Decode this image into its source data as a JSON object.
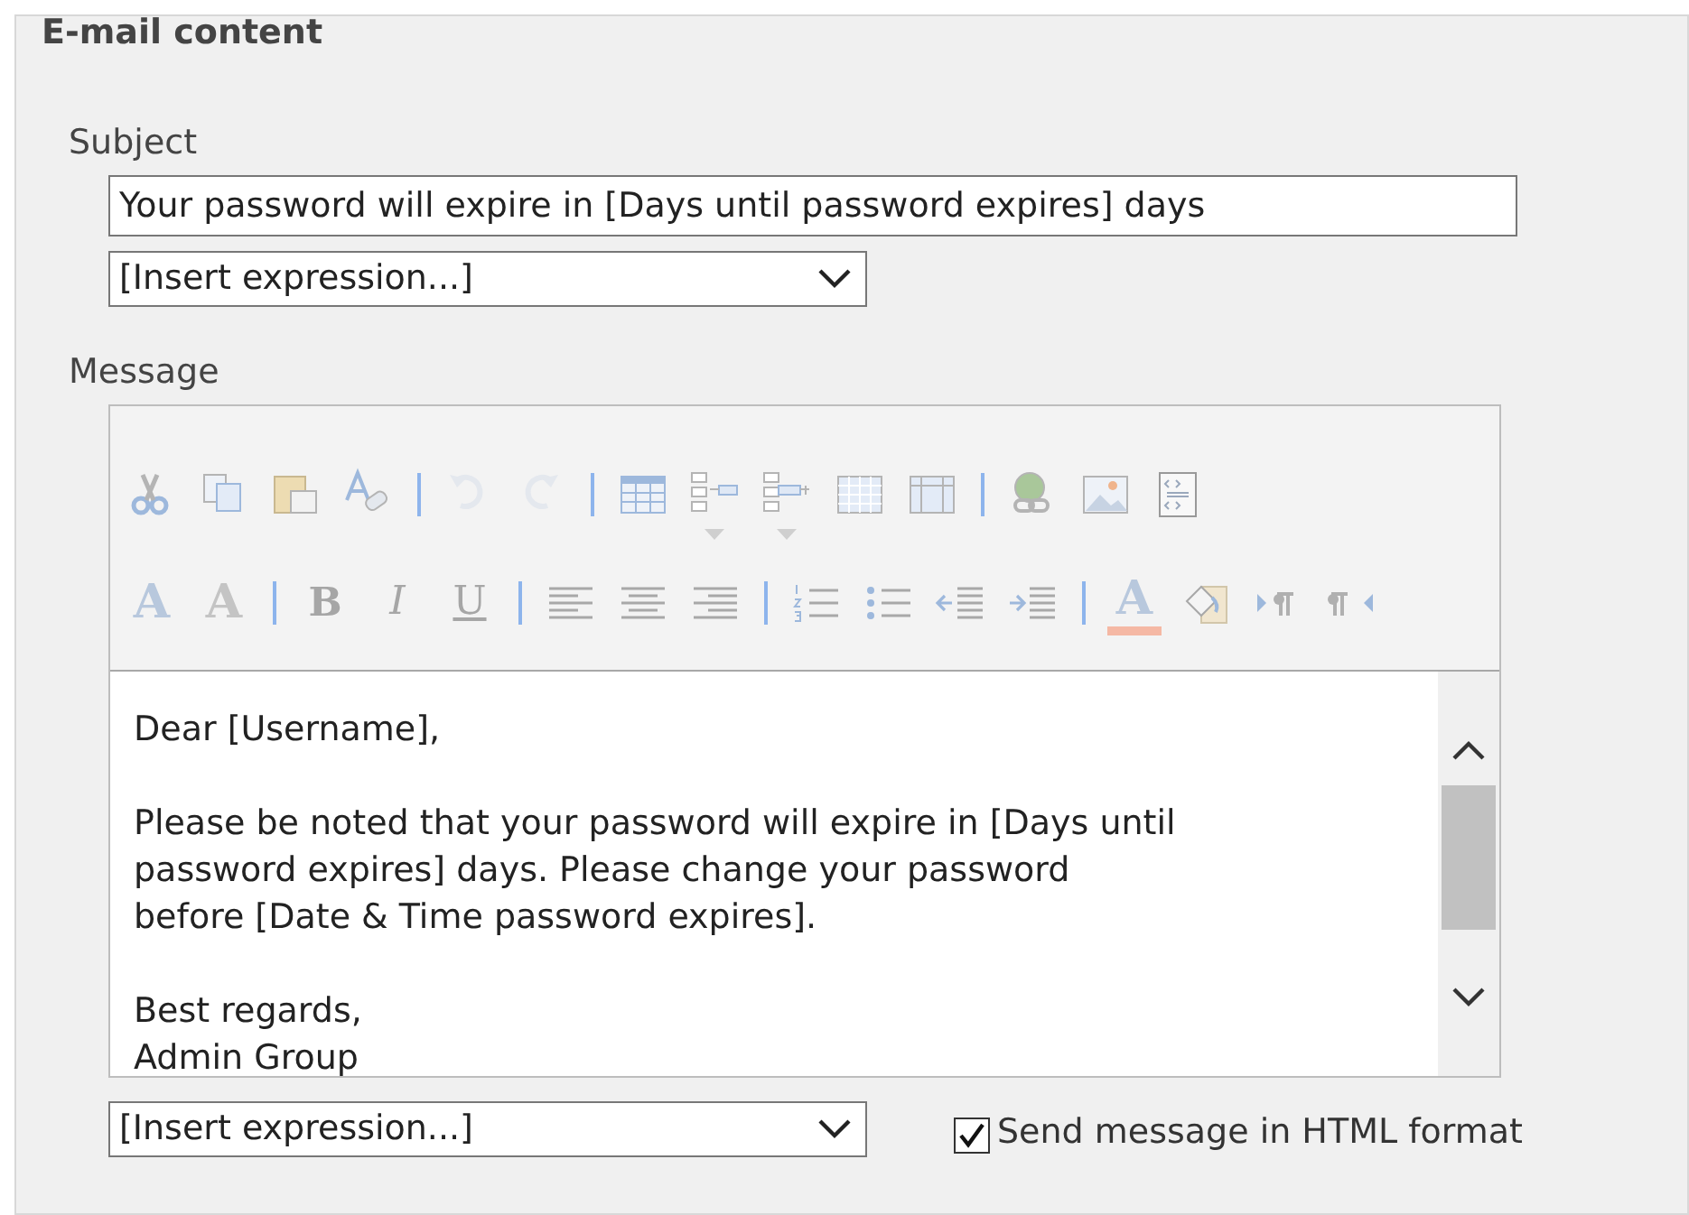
{
  "section": {
    "title": "E-mail content"
  },
  "subject": {
    "label": "Subject",
    "value": "Your password will expire in [Days until password expires] days",
    "expression_select": {
      "value": "[Insert expression...]"
    }
  },
  "message": {
    "label": "Message",
    "toolbar_rows": [
      [
        {
          "kind": "cut"
        },
        {
          "kind": "copy"
        },
        {
          "kind": "paste"
        },
        {
          "kind": "spell"
        },
        {
          "kind": "sep"
        },
        {
          "kind": "undo"
        },
        {
          "kind": "redo"
        },
        {
          "kind": "sep"
        },
        {
          "kind": "table"
        },
        {
          "kind": "insert-row"
        },
        {
          "kind": "insert-col"
        },
        {
          "kind": "grid"
        },
        {
          "kind": "table-props"
        },
        {
          "kind": "sep"
        },
        {
          "kind": "link"
        },
        {
          "kind": "image"
        },
        {
          "kind": "source"
        }
      ],
      [
        {
          "kind": "font",
          "glyph": "A"
        },
        {
          "kind": "size",
          "glyph": "A"
        },
        {
          "kind": "sep"
        },
        {
          "kind": "bold",
          "glyph": "B"
        },
        {
          "kind": "italic",
          "glyph": "I"
        },
        {
          "kind": "underline",
          "glyph": "U"
        },
        {
          "kind": "sep"
        },
        {
          "kind": "align-left"
        },
        {
          "kind": "align-center"
        },
        {
          "kind": "align-right"
        },
        {
          "kind": "sep"
        },
        {
          "kind": "numbered"
        },
        {
          "kind": "bulleted"
        },
        {
          "kind": "outdent"
        },
        {
          "kind": "indent"
        },
        {
          "kind": "sep"
        },
        {
          "kind": "color",
          "glyph": "A"
        },
        {
          "kind": "fill"
        },
        {
          "kind": "ltr"
        },
        {
          "kind": "rtl"
        }
      ]
    ],
    "body": [
      [
        "Dear [Username],"
      ],
      [
        "Please be noted that your password will expire in [Days until",
        "password expires] days. Please change your password",
        "before [Date & Time password expires]."
      ],
      [
        "Best regards,",
        "Admin Group"
      ]
    ],
    "expression_select": {
      "value": "[Insert expression...]"
    },
    "html_format": {
      "label": "Send message in HTML format",
      "checked": true
    }
  }
}
